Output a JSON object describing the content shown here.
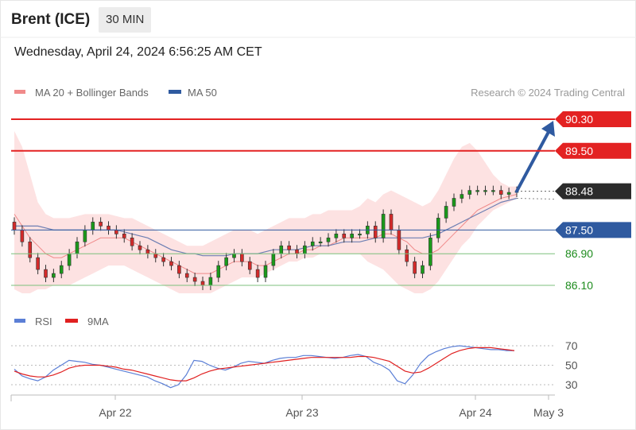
{
  "header": {
    "instrument": "Brent (ICE)",
    "interval": "30 MIN"
  },
  "timestamp": "Wednesday, April 24, 2024 6:56:25 AM CET",
  "legend": {
    "ma20": {
      "label": "MA 20 + Bollinger Bands",
      "color": "#f08a8a"
    },
    "ma50": {
      "label": "MA 50",
      "color": "#2f5aa0"
    },
    "credit": "Research © 2024 Trading Central"
  },
  "rsi_legend": {
    "rsi": {
      "label": "RSI",
      "color": "#5b7fd6"
    },
    "ma9": {
      "label": "9MA",
      "color": "#e02020"
    }
  },
  "colors": {
    "resistance": "#e32222",
    "support": "#1e8c1e",
    "pivot": "#2f5aa0",
    "current": "#2b2b2b",
    "band": "#fde2e2",
    "candle_up": "#1a9a1a",
    "candle_down": "#d42a2a",
    "arrow": "#2f5aa0"
  },
  "chart_data": [
    {
      "type": "candlestick",
      "title": "Brent (ICE)",
      "interval": "30 MIN",
      "xlabel": "",
      "ylabel": "",
      "x_ticks": [
        "Apr 22",
        "Apr 23",
        "Apr 24",
        "May 3"
      ],
      "ylim": [
        85.8,
        90.6
      ],
      "levels": [
        {
          "value": 90.3,
          "label": "90.30",
          "kind": "resistance"
        },
        {
          "value": 89.5,
          "label": "89.50",
          "kind": "resistance"
        },
        {
          "value": 88.48,
          "label": "88.48",
          "kind": "current"
        },
        {
          "value": 87.5,
          "label": "87.50",
          "kind": "pivot"
        },
        {
          "value": 86.9,
          "label": "86.90",
          "kind": "support"
        },
        {
          "value": 86.1,
          "label": "86.10",
          "kind": "support"
        }
      ],
      "close_series": [
        87.5,
        87.2,
        86.8,
        86.5,
        86.3,
        86.4,
        86.6,
        86.9,
        87.2,
        87.5,
        87.7,
        87.6,
        87.5,
        87.4,
        87.3,
        87.1,
        87.0,
        86.9,
        86.8,
        86.7,
        86.6,
        86.4,
        86.3,
        86.2,
        86.1,
        86.3,
        86.6,
        86.8,
        86.9,
        86.7,
        86.5,
        86.3,
        86.6,
        86.9,
        87.1,
        87.0,
        86.9,
        87.1,
        87.2,
        87.2,
        87.3,
        87.4,
        87.3,
        87.4,
        87.4,
        87.6,
        87.3,
        87.9,
        87.5,
        87.0,
        86.7,
        86.4,
        86.6,
        87.3,
        87.8,
        88.1,
        88.3,
        88.4,
        88.5,
        88.5,
        88.5,
        88.5,
        88.4,
        88.45,
        88.48
      ],
      "ma20_series": [
        87.9,
        87.6,
        87.3,
        87.1,
        86.9,
        86.8,
        86.8,
        86.9,
        87.0,
        87.1,
        87.2,
        87.3,
        87.3,
        87.3,
        87.3,
        87.2,
        87.1,
        87.0,
        86.9,
        86.8,
        86.7,
        86.6,
        86.5,
        86.4,
        86.4,
        86.4,
        86.5,
        86.6,
        86.7,
        86.7,
        86.7,
        86.6,
        86.6,
        86.7,
        86.8,
        86.9,
        86.9,
        87.0,
        87.0,
        87.1,
        87.1,
        87.2,
        87.3,
        87.3,
        87.3,
        87.3,
        87.3,
        87.4,
        87.4,
        87.3,
        87.2,
        87.0,
        86.9,
        86.9,
        87.0,
        87.2,
        87.4,
        87.6,
        87.8,
        88.0,
        88.1,
        88.2,
        88.3,
        88.35,
        88.4
      ],
      "ma50_series": [
        87.6,
        87.6,
        87.6,
        87.6,
        87.55,
        87.5,
        87.5,
        87.5,
        87.5,
        87.5,
        87.5,
        87.5,
        87.5,
        87.5,
        87.45,
        87.4,
        87.35,
        87.3,
        87.2,
        87.1,
        87.0,
        86.95,
        86.9,
        86.9,
        86.85,
        86.85,
        86.85,
        86.85,
        86.9,
        86.9,
        86.9,
        86.9,
        86.95,
        87.0,
        87.0,
        87.0,
        87.0,
        87.05,
        87.1,
        87.1,
        87.1,
        87.15,
        87.2,
        87.2,
        87.2,
        87.25,
        87.3,
        87.3,
        87.3,
        87.3,
        87.3,
        87.3,
        87.3,
        87.35,
        87.4,
        87.5,
        87.6,
        87.7,
        87.8,
        87.9,
        88.0,
        88.1,
        88.2,
        88.25,
        88.3
      ],
      "bb_upper_series": [
        90.0,
        89.6,
        88.9,
        88.2,
        87.9,
        87.8,
        87.8,
        87.8,
        87.85,
        87.9,
        87.9,
        87.9,
        87.9,
        87.85,
        87.8,
        87.8,
        87.7,
        87.6,
        87.5,
        87.4,
        87.3,
        87.2,
        87.1,
        87.1,
        87.1,
        87.2,
        87.3,
        87.4,
        87.5,
        87.5,
        87.5,
        87.4,
        87.5,
        87.6,
        87.7,
        87.8,
        87.8,
        87.8,
        87.9,
        87.9,
        88.0,
        88.0,
        88.0,
        88.0,
        88.1,
        88.3,
        88.2,
        88.4,
        88.5,
        88.4,
        88.3,
        88.2,
        88.1,
        88.2,
        88.5,
        88.9,
        89.3,
        89.6,
        89.7,
        89.5,
        89.2,
        88.9,
        88.7,
        88.6,
        88.6
      ],
      "bb_lower_series": [
        86.0,
        85.9,
        85.9,
        86.0,
        86.0,
        86.1,
        86.1,
        86.1,
        86.2,
        86.3,
        86.4,
        86.5,
        86.6,
        86.6,
        86.6,
        86.5,
        86.4,
        86.3,
        86.2,
        86.1,
        86.0,
        85.9,
        85.9,
        85.9,
        85.9,
        85.9,
        86.0,
        86.1,
        86.2,
        86.3,
        86.3,
        86.3,
        86.4,
        86.5,
        86.6,
        86.7,
        86.7,
        86.8,
        86.8,
        86.9,
        86.9,
        86.9,
        86.9,
        86.9,
        86.9,
        86.7,
        86.6,
        86.5,
        86.3,
        86.1,
        86.0,
        85.9,
        85.9,
        86.0,
        86.2,
        86.5,
        86.8,
        87.1,
        87.3,
        87.6,
        87.8,
        88.0,
        88.1,
        88.2,
        88.3
      ],
      "forecast": {
        "from": 88.48,
        "to": 90.3
      }
    },
    {
      "type": "line",
      "title": "",
      "xlabel": "",
      "ylabel": "",
      "y_ticks": [
        "70",
        "50",
        "30"
      ],
      "ylim": [
        20,
        80
      ],
      "reference_lines": [
        70,
        50,
        30
      ],
      "series": [
        {
          "name": "RSI",
          "values": [
            46,
            39,
            36,
            34,
            38,
            45,
            50,
            55,
            54,
            53,
            51,
            50,
            48,
            46,
            44,
            42,
            40,
            38,
            34,
            31,
            27,
            30,
            40,
            55,
            54,
            50,
            47,
            45,
            48,
            52,
            54,
            53,
            52,
            55,
            57,
            58,
            58,
            60,
            60,
            59,
            58,
            57,
            58,
            60,
            61,
            59,
            53,
            50,
            45,
            34,
            31,
            40,
            52,
            60,
            64,
            67,
            69,
            70,
            69,
            68,
            67,
            66,
            66,
            65,
            65
          ]
        },
        {
          "name": "9MA",
          "values": [
            44,
            41,
            39,
            38,
            38,
            40,
            43,
            47,
            49,
            50,
            50,
            50,
            49,
            48,
            46,
            45,
            43,
            41,
            39,
            37,
            35,
            34,
            34,
            37,
            41,
            44,
            46,
            47,
            48,
            49,
            50,
            51,
            52,
            53,
            54,
            55,
            56,
            57,
            58,
            58,
            58,
            58,
            58,
            58,
            59,
            59,
            58,
            56,
            54,
            49,
            44,
            42,
            43,
            47,
            52,
            57,
            62,
            65,
            67,
            68,
            68,
            68,
            67,
            66,
            65
          ]
        }
      ]
    }
  ]
}
